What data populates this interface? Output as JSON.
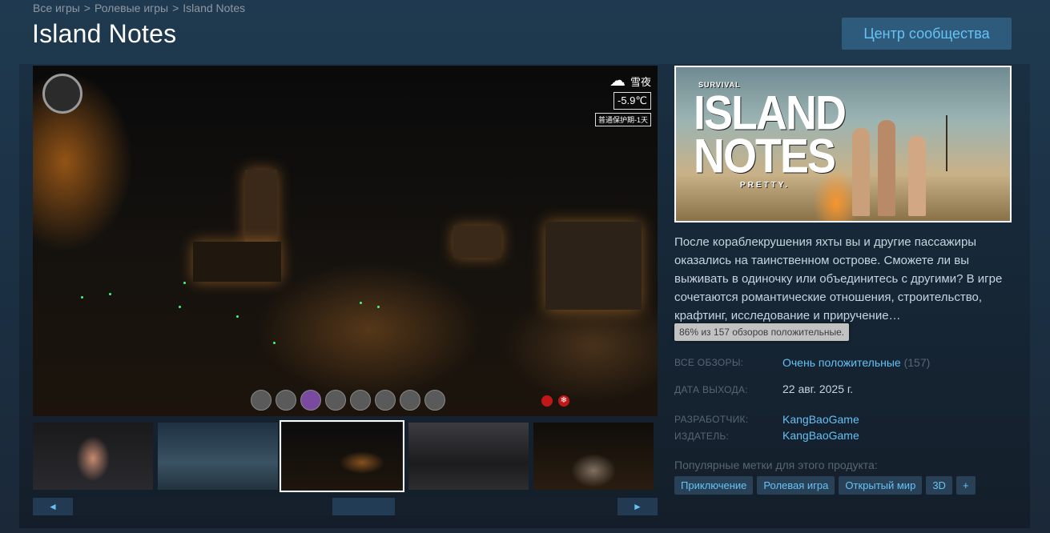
{
  "breadcrumb": {
    "items": [
      "Все игры",
      "Ролевые игры",
      "Island Notes"
    ],
    "separator": ">"
  },
  "app": {
    "title": "Island Notes"
  },
  "community_button": {
    "label": "Центр сообщества"
  },
  "screenshot": {
    "weather_top": "雪夜",
    "temperature": "-5.9℃",
    "weather_bottom": "普通保护期-1天",
    "weather_icon": "snow-cloud-icon"
  },
  "thumbnails": {
    "count": 5,
    "active_index": 2
  },
  "scroll": {
    "left_arrow": "◄",
    "right_arrow": "►"
  },
  "header_image": {
    "logo_top": "SURVIVAL",
    "logo_line1": "ISLAND",
    "logo_line2": "NOTES",
    "logo_bottom": "PRETTY."
  },
  "description": "После кораблекрушения яхты вы и другие пассажиры оказались на таинственном острове. Сможете ли вы выживать в одиночку или объединитесь с другими? В игре сочетаются романтические отношения, строительство, крафтинг, исследование и приручение…",
  "tooltip": "86% из 157 обзоров положительные.",
  "reviews": {
    "label": "ВСЕ ОБЗОРЫ:",
    "summary": "Очень положительные",
    "count": "(157)"
  },
  "release": {
    "label": "ДАТА ВЫХОДА:",
    "date": "22 авг. 2025 г."
  },
  "developer": {
    "label": "РАЗРАБОТЧИК:",
    "name": "KangBaoGame"
  },
  "publisher": {
    "label": "ИЗДАТЕЛЬ:",
    "name": "KangBaoGame"
  },
  "tags": {
    "label": "Популярные метки для этого продукта:",
    "items": [
      "Приключение",
      "Ролевая игра",
      "Открытый мир",
      "3D",
      "+"
    ]
  },
  "colors": {
    "page_bg": "#1b2838",
    "link": "#66c0f4",
    "button_bg": "#2e5b7c",
    "tag_bg": "#284157"
  }
}
